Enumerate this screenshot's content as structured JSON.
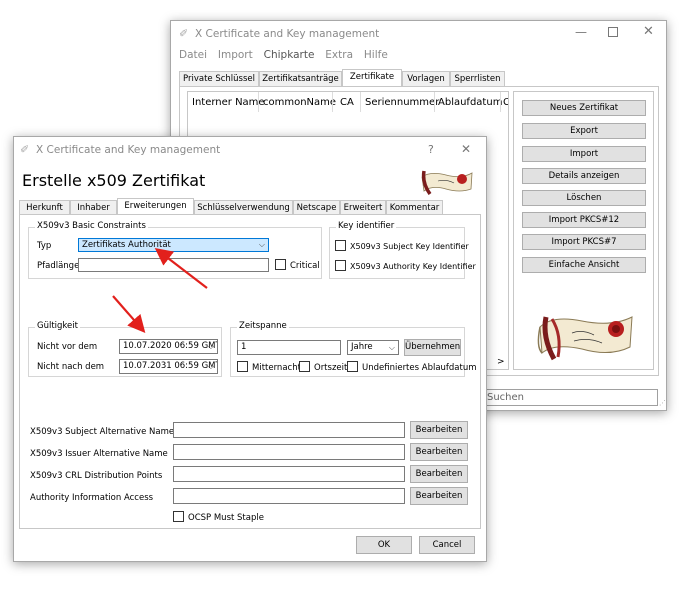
{
  "back_window": {
    "title": "X Certificate and Key management",
    "menu": [
      "Datei",
      "Import",
      "Chipkarte",
      "Extra",
      "Hilfe"
    ],
    "tabs": [
      "Private Schlüssel",
      "Zertifikatsanträge",
      "Zertifikate",
      "Vorlagen",
      "Sperrlisten"
    ],
    "active_tab": "Zertifikate",
    "columns": [
      "Interner Name",
      "commonName",
      "CA",
      "Seriennummer",
      "Ablaufdatum",
      "C"
    ],
    "buttons": [
      "Neues Zertifikat",
      "Export",
      "Import",
      "Details anzeigen",
      "Löschen",
      "Import PKCS#12",
      "Import PKCS#7",
      "Einfache Ansicht"
    ],
    "search_placeholder": "Suchen",
    "scroll_right_arrow": ">"
  },
  "dialog": {
    "title": "X Certificate and Key management",
    "help_icon": "?",
    "close_icon": "✕",
    "heading": "Erstelle x509 Zertifikat",
    "tabs": [
      "Herkunft",
      "Inhaber",
      "Erweiterungen",
      "Schlüsselverwendung",
      "Netscape",
      "Erweitert",
      "Kommentar"
    ],
    "active_tab": "Erweiterungen",
    "basic_constraints": {
      "title": "X509v3 Basic Constraints",
      "type_label": "Typ",
      "type_value": "Zertifikats Authorität",
      "path_label": "Pfadlänge",
      "path_value": "",
      "critical_label": "Critical"
    },
    "key_identifier": {
      "title": "Key identifier",
      "subject_label": "X509v3 Subject Key Identifier",
      "authority_label": "X509v3 Authority Key Identifier"
    },
    "validity": {
      "title": "Gültigkeit",
      "not_before_label": "Nicht vor dem",
      "not_before_value": "10.07.2020 06:59 GMT",
      "not_after_label": "Nicht nach dem",
      "not_after_value": "10.07.2031 06:59 GMT"
    },
    "time_range": {
      "title": "Zeitspanne",
      "amount": "1",
      "unit": "Jahre",
      "apply_label": "Übernehmen",
      "midnight_label": "Mitternacht",
      "local_label": "Ortszeit",
      "undefined_label": "Undefiniertes Ablaufdatum"
    },
    "extensions": [
      {
        "label": "X509v3 Subject Alternative Name",
        "value": "",
        "button": "Bearbeiten"
      },
      {
        "label": "X509v3 Issuer Alternative Name",
        "value": "",
        "button": "Bearbeiten"
      },
      {
        "label": "X509v3 CRL Distribution Points",
        "value": "",
        "button": "Bearbeiten"
      },
      {
        "label": "Authority Information Access",
        "value": "",
        "button": "Bearbeiten"
      }
    ],
    "ocsp_label": "OCSP Must Staple",
    "ok_label": "OK",
    "cancel_label": "Cancel"
  },
  "colors": {
    "annotation_arrow": "#e2201c",
    "selected_field": "#cce8ff",
    "selected_border": "#0078d7"
  }
}
